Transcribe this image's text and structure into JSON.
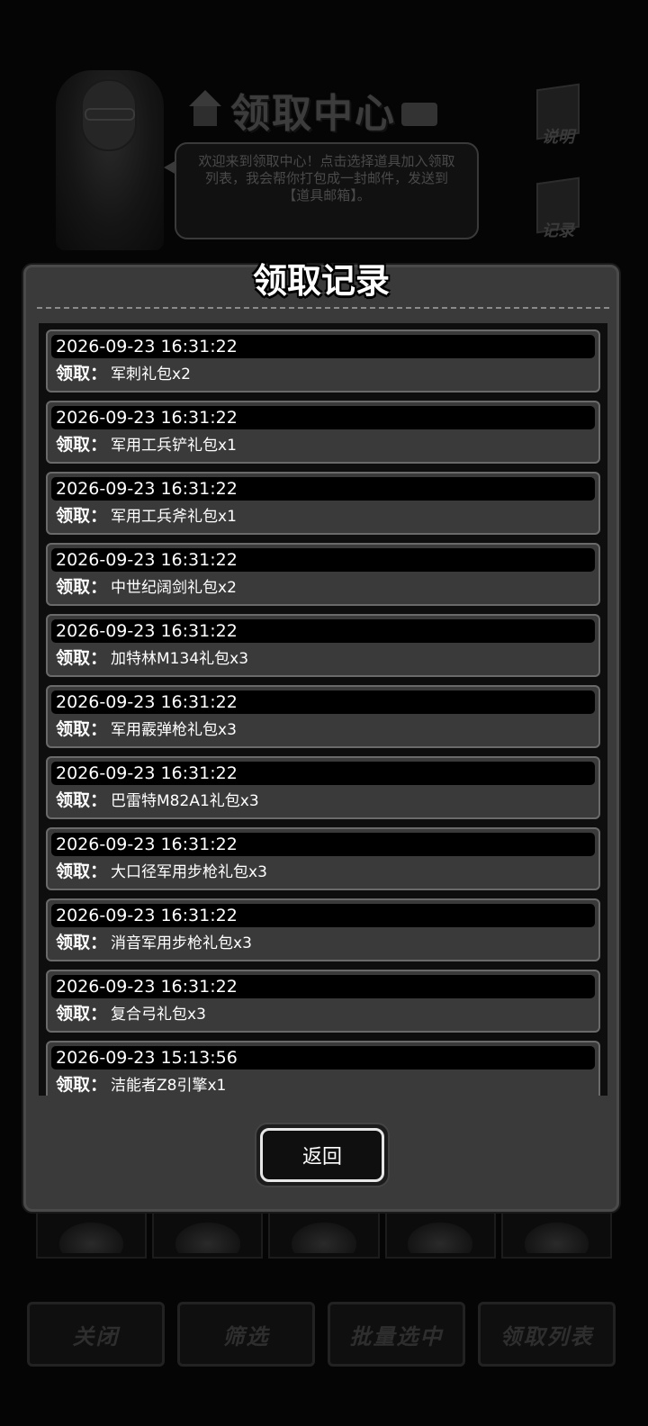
{
  "background": {
    "title": "领取中心",
    "bubble_text": "欢迎来到领取中心！点击选择道具加入领取列表，我会帮你打包成一封邮件，发送到【道具邮箱】。",
    "side_buttons": [
      "说明",
      "记录"
    ],
    "bottom_buttons": [
      "关闭",
      "筛选",
      "批量选中",
      "领取列表"
    ]
  },
  "modal": {
    "title": "领取记录",
    "claim_label": "领取：",
    "records": [
      {
        "time": "2026-09-23 16:31:22",
        "item": "军刺礼包x2"
      },
      {
        "time": "2026-09-23 16:31:22",
        "item": "军用工兵铲礼包x1"
      },
      {
        "time": "2026-09-23 16:31:22",
        "item": "军用工兵斧礼包x1"
      },
      {
        "time": "2026-09-23 16:31:22",
        "item": "中世纪阔剑礼包x2"
      },
      {
        "time": "2026-09-23 16:31:22",
        "item": "加特林M134礼包x3"
      },
      {
        "time": "2026-09-23 16:31:22",
        "item": "军用霰弹枪礼包x3"
      },
      {
        "time": "2026-09-23 16:31:22",
        "item": "巴雷特M82A1礼包x3"
      },
      {
        "time": "2026-09-23 16:31:22",
        "item": "大口径军用步枪礼包x3"
      },
      {
        "time": "2026-09-23 16:31:22",
        "item": "消音军用步枪礼包x3"
      },
      {
        "time": "2026-09-23 16:31:22",
        "item": "复合弓礼包x3"
      },
      {
        "time": "2026-09-23 15:13:56",
        "item": "洁能者Z8引擎x1"
      }
    ],
    "back_label": "返回"
  }
}
